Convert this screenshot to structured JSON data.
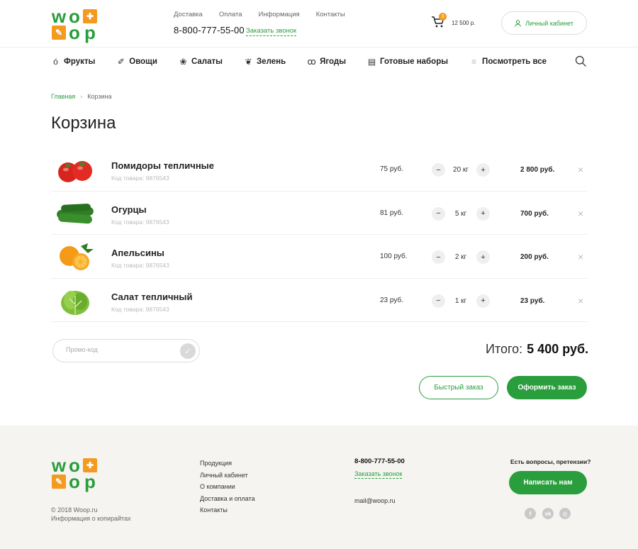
{
  "brand": {
    "logo_top": [
      "w",
      "o",
      "",
      "",
      "o",
      "p"
    ],
    "accent": "#2a9d3c",
    "orange": "#f39a1f"
  },
  "header": {
    "nav": [
      "Доставка",
      "Оплата",
      "Информация",
      "Контакты"
    ],
    "phone": "8-800-777-55-00",
    "callback": "Заказать звонок",
    "cart_count": "3",
    "cart_sum": "12 500 р.",
    "account": "Личный кабинет"
  },
  "categories": [
    {
      "label": "Фрукты",
      "icon": "apple-icon"
    },
    {
      "label": "Овощи",
      "icon": "carrot-icon"
    },
    {
      "label": "Салаты",
      "icon": "salad-icon"
    },
    {
      "label": "Зелень",
      "icon": "leaf-icon"
    },
    {
      "label": "Ягоды",
      "icon": "berries-icon"
    },
    {
      "label": "Готовые наборы",
      "icon": "bag-icon"
    },
    {
      "label": "Посмотреть все",
      "icon": "menu-icon"
    }
  ],
  "breadcrumb": {
    "home": "Главная",
    "current": "Корзина"
  },
  "page_title": "Корзина",
  "items": [
    {
      "name": "Помидоры тепличные",
      "code": "Код товара: 9876543",
      "price": "75 руб.",
      "qty": "20 кг",
      "total": "2 800 руб.",
      "image": "tomato"
    },
    {
      "name": "Огурцы",
      "code": "Код товара: 9876543",
      "price": "81 руб.",
      "qty": "5 кг",
      "total": "700 руб.",
      "image": "cucumber"
    },
    {
      "name": "Апельсины",
      "code": "Код товара: 9876543",
      "price": "100 руб.",
      "qty": "2 кг",
      "total": "200 руб.",
      "image": "orange"
    },
    {
      "name": "Салат тепличный",
      "code": "Код товара: 9876543",
      "price": "23 руб.",
      "qty": "1 кг",
      "total": "23 руб.",
      "image": "lettuce"
    }
  ],
  "promo": {
    "placeholder": "Промо-код"
  },
  "summary": {
    "label": "Итого:",
    "value": "5 400 руб."
  },
  "actions": {
    "quick": "Быстрый заказ",
    "checkout": "Оформить заказ"
  },
  "footer": {
    "copyright": "© 2018 Woop.ru",
    "copyright_info": "Информация о копирайтах",
    "nav": [
      "Продукция",
      "Личный кабинет",
      "О компании",
      "Доставка и оплата",
      "Контакты"
    ],
    "phone": "8-800-777-55-00",
    "callback": "Заказать звонок",
    "email": "mail@woop.ru",
    "question": "Есть вопросы, претензии?",
    "write": "Написать нам",
    "social": [
      "facebook-icon",
      "vk-icon",
      "instagram-icon"
    ]
  }
}
